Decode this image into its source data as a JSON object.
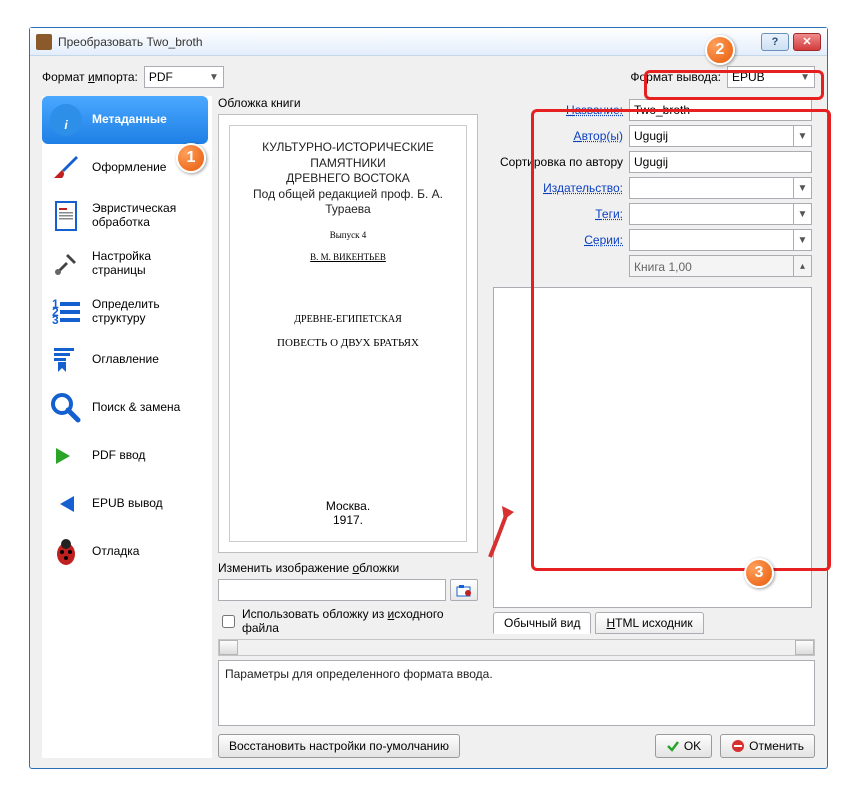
{
  "window": {
    "title": "Преобразовать Two_broth"
  },
  "format": {
    "import_label": "Формат импорта:",
    "import_value": "PDF",
    "output_label": "Формат вывода:",
    "output_value": "EPUB"
  },
  "sidebar": {
    "items": [
      {
        "label": "Метаданные"
      },
      {
        "label": "Оформление"
      },
      {
        "label": "Эвристическая обработка"
      },
      {
        "label": "Настройка страницы"
      },
      {
        "label": "Определить структуру"
      },
      {
        "label": "Оглавление"
      },
      {
        "label": "Поиск & замена"
      },
      {
        "label": "PDF ввод"
      },
      {
        "label": "EPUB вывод"
      },
      {
        "label": "Отладка"
      }
    ]
  },
  "cover": {
    "group_title": "Обложка книги",
    "page": {
      "line1": "КУЛЬТУРНО-ИСТОРИЧЕСКИЕ ПАМЯТНИКИ",
      "line2": "ДРЕВНЕГО ВОСТОКА",
      "line3": "Под общей редакцией проф. Б. А. Тураева",
      "issue": "Выпуск 4",
      "author": "В. М. ВИКЕНТЬЕВ",
      "title1": "ДРЕВНЕ-ЕГИПЕТСКАЯ",
      "title2": "ПОВЕСТЬ О ДВУХ БРАТЬЯХ",
      "city": "Москва.",
      "year": "1917."
    },
    "change_label": "Изменить изображение обложки",
    "path_value": "",
    "use_source_label": "Использовать обложку из исходного файла"
  },
  "meta": {
    "fields": {
      "title_label": "Название:",
      "title_value": "Two_broth",
      "author_label": "Автор(ы)",
      "author_value": "Ugugij",
      "author_sort_label": "Сортировка по автору",
      "author_sort_value": "Ugugij",
      "publisher_label": "Издательство:",
      "publisher_value": "",
      "tags_label": "Теги:",
      "tags_value": "",
      "series_label": "Серии:",
      "series_value": "",
      "series_index_value": "Книга 1,00"
    },
    "tabs": {
      "normal": "Обычный вид",
      "html": "HTML исходник"
    }
  },
  "help_text": "Параметры для определенного формата ввода.",
  "buttons": {
    "restore": "Восстановить настройки по-умолчанию",
    "ok": "OK",
    "cancel": "Отменить"
  },
  "badges": {
    "b1": "1",
    "b2": "2",
    "b3": "3"
  }
}
